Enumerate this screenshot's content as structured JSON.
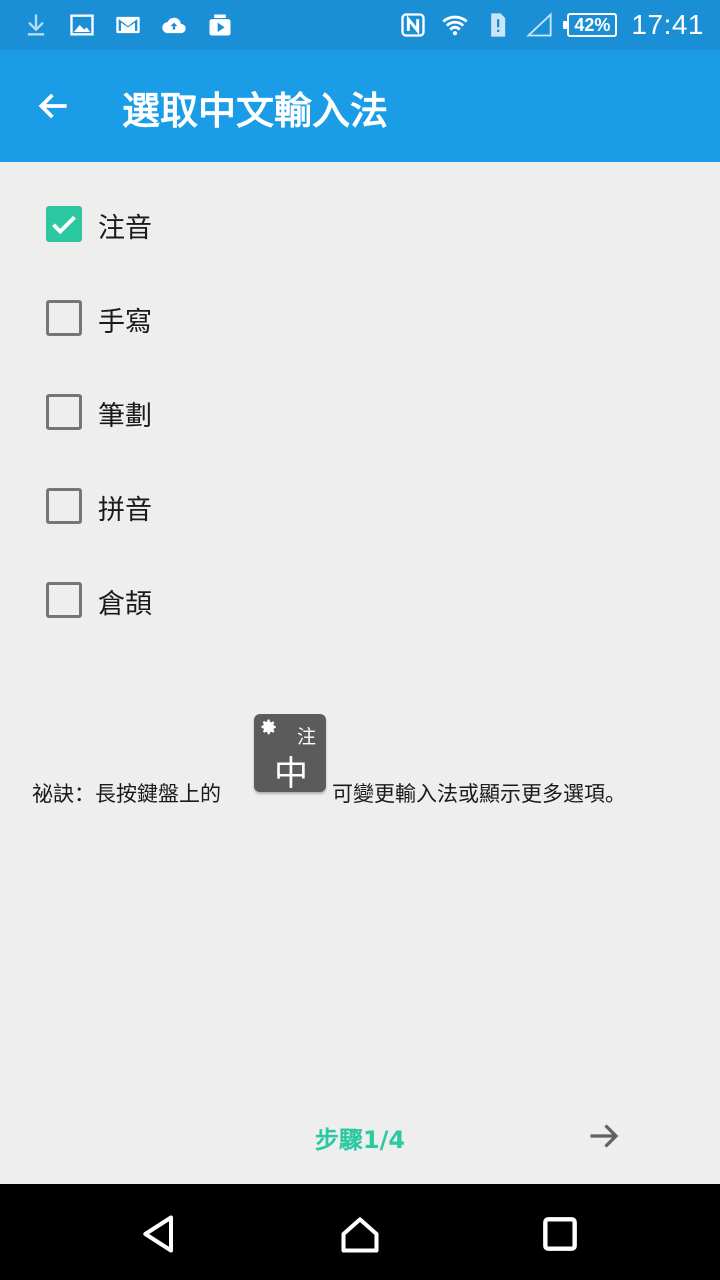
{
  "status_bar": {
    "left_icons": [
      "download-icon",
      "image-icon",
      "gmail-icon",
      "cloud-upload-icon",
      "video-share-icon"
    ],
    "right_icons": [
      "nfc-icon",
      "wifi-icon",
      "sim-alert-icon",
      "signal-icon"
    ],
    "battery_text": "42%",
    "time": "17:41"
  },
  "app_bar": {
    "title": "選取中文輸入法",
    "color": "#1a9ce6"
  },
  "options": [
    {
      "label": "注音",
      "checked": true
    },
    {
      "label": "手寫",
      "checked": false
    },
    {
      "label": "筆劃",
      "checked": false
    },
    {
      "label": "拼音",
      "checked": false
    },
    {
      "label": "倉頡",
      "checked": false
    }
  ],
  "tip": {
    "prefix": "祕訣：長按鍵盤上的",
    "key_small": "注",
    "key_big": "中",
    "suffix": "可變更輸入法或顯示更多選項。"
  },
  "footer": {
    "step_text": "步驟1/4",
    "accent_color": "#2bc8a1"
  },
  "nav_bar": {
    "buttons": [
      "back-icon",
      "home-icon",
      "recents-icon"
    ]
  }
}
